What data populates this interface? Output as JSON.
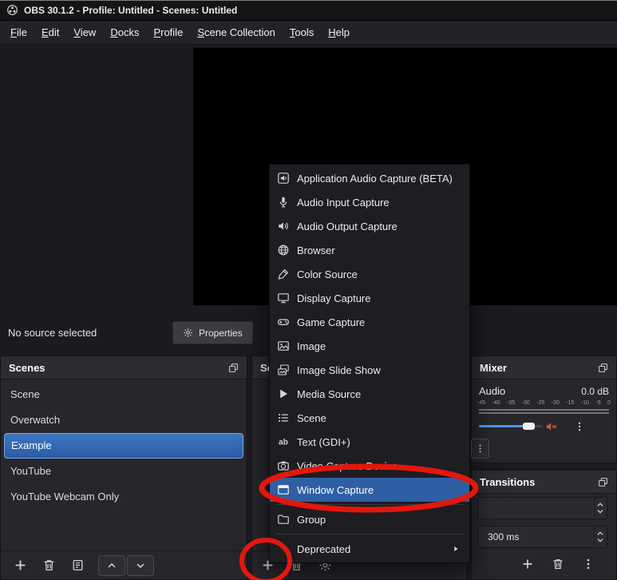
{
  "window": {
    "title": "OBS 30.1.2 - Profile: Untitled - Scenes: Untitled"
  },
  "menubar": {
    "items": [
      "File",
      "Edit",
      "View",
      "Docks",
      "Profile",
      "Scene Collection",
      "Tools",
      "Help"
    ]
  },
  "source_status": {
    "message": "No source selected",
    "properties_button": "Properties"
  },
  "scenes_panel": {
    "title": "Scenes",
    "items": [
      {
        "label": "Scene",
        "selected": false
      },
      {
        "label": "Overwatch",
        "selected": false
      },
      {
        "label": "Example",
        "selected": true
      },
      {
        "label": "YouTube",
        "selected": false
      },
      {
        "label": "YouTube Webcam Only",
        "selected": false
      }
    ],
    "toolbar": [
      {
        "icon": "plus-icon",
        "name": "add-scene-button"
      },
      {
        "icon": "trash-icon",
        "name": "remove-scene-button"
      },
      {
        "icon": "filters-icon",
        "name": "scene-filters-button"
      },
      {
        "icon": "chevron-up-icon",
        "name": "move-scene-up-button",
        "boxed": true
      },
      {
        "icon": "chevron-down-icon",
        "name": "move-scene-down-button",
        "boxed": true
      }
    ]
  },
  "sources_panel": {
    "title": "Sources",
    "toolbar": [
      {
        "icon": "plus-icon",
        "name": "add-source-button"
      },
      {
        "icon": "trash-icon",
        "name": "remove-source-button"
      },
      {
        "icon": "gear-icon",
        "name": "source-properties-button"
      }
    ]
  },
  "mixer_panel": {
    "title": "Mixer",
    "channel_name": "Audio",
    "level_db": "0.0 dB",
    "meter_ticks": [
      "-45",
      "-40",
      "-35",
      "-30",
      "-25",
      "-20",
      "-15",
      "-10",
      "-5",
      "0"
    ],
    "volume_percent": 78,
    "muted": true
  },
  "transitions_panel": {
    "title": "Transitions",
    "duration_value": "300 ms",
    "toolbar": [
      {
        "icon": "plus-icon",
        "name": "add-transition-button"
      },
      {
        "icon": "trash-icon",
        "name": "remove-transition-button"
      },
      {
        "icon": "dots-vertical-icon",
        "name": "transition-properties-button"
      }
    ]
  },
  "add_source_menu": {
    "items": [
      {
        "label": "Application Audio Capture (BETA)",
        "icon": "application-audio-capture-icon"
      },
      {
        "label": "Audio Input Capture",
        "icon": "microphone-icon"
      },
      {
        "label": "Audio Output Capture",
        "icon": "speaker-icon"
      },
      {
        "label": "Browser",
        "icon": "globe-icon"
      },
      {
        "label": "Color Source",
        "icon": "color-dropper-icon"
      },
      {
        "label": "Display Capture",
        "icon": "monitor-icon"
      },
      {
        "label": "Game Capture",
        "icon": "gamepad-icon"
      },
      {
        "label": "Image",
        "icon": "image-icon"
      },
      {
        "label": "Image Slide Show",
        "icon": "slideshow-icon"
      },
      {
        "label": "Media Source",
        "icon": "play-icon"
      },
      {
        "label": "Scene",
        "icon": "scene-list-icon"
      },
      {
        "label": "Text (GDI+)",
        "icon": "text-ab-icon"
      },
      {
        "label": "Video Capture Device",
        "icon": "camera-icon"
      },
      {
        "label": "Window Capture",
        "icon": "window-icon",
        "selected": true
      },
      {
        "label": "Group",
        "icon": "folder-icon",
        "separator_before": true
      },
      {
        "label": "Deprecated",
        "icon": "none",
        "submenu": true,
        "separator_before": true
      }
    ]
  },
  "icons": {
    "app_logo": "obs-logo-icon",
    "popout": "popout-icon",
    "properties_gear": "gear-icon",
    "mute": "speaker-muted-icon",
    "dots": "dots-vertical-icon",
    "spinner": "spinner-updown-icon"
  },
  "annotations": {
    "color": "#e3170d"
  },
  "colors": {
    "selection_blue": "#2e5fa3"
  }
}
